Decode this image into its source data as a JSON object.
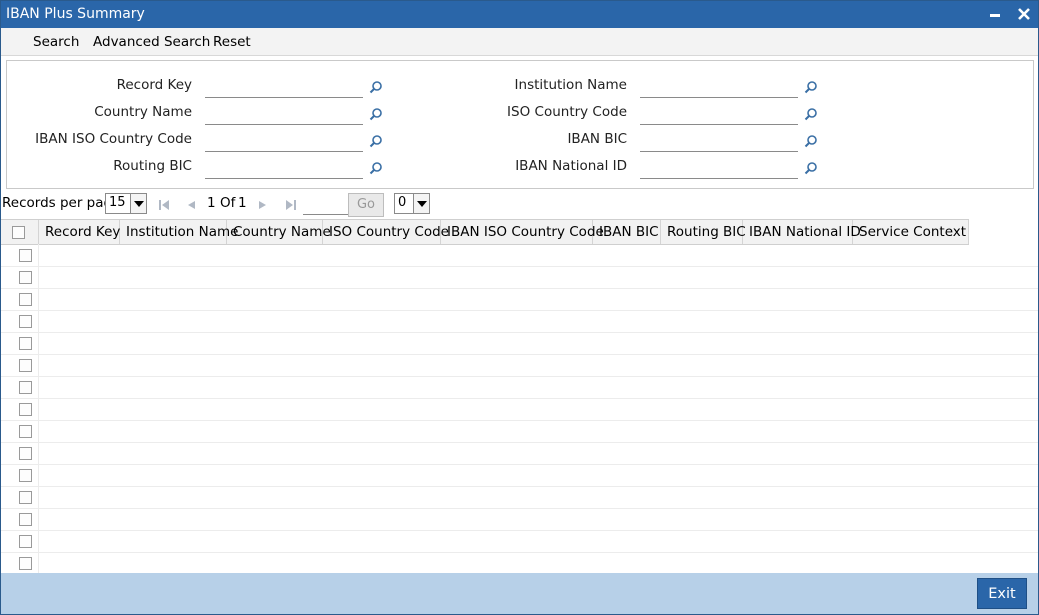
{
  "window": {
    "title": "IBAN Plus Summary"
  },
  "menu": {
    "items": [
      "Search",
      "Advanced Search",
      "Reset"
    ]
  },
  "criteria": {
    "left": [
      {
        "label": "Record Key",
        "value": ""
      },
      {
        "label": "Country Name",
        "value": ""
      },
      {
        "label": "IBAN ISO Country Code",
        "value": ""
      },
      {
        "label": "Routing BIC",
        "value": ""
      }
    ],
    "right": [
      {
        "label": "Institution Name",
        "value": ""
      },
      {
        "label": "ISO Country Code",
        "value": ""
      },
      {
        "label": "IBAN BIC",
        "value": ""
      },
      {
        "label": "IBAN National ID",
        "value": ""
      }
    ]
  },
  "pager": {
    "records_per_page_label": "Records per page",
    "records_per_page": "15",
    "current_page": "1",
    "of_label": "Of",
    "total_pages": "1",
    "go_label": "Go",
    "filter_value": "0"
  },
  "grid": {
    "columns": [
      "Record Key",
      "Institution Name",
      "Country Name",
      "ISO Country Code",
      "IBAN ISO Country Code",
      "IBAN BIC",
      "Routing BIC",
      "IBAN National ID",
      "Service Context"
    ]
  },
  "footer": {
    "exit_label": "Exit"
  },
  "colors": {
    "titlebar": "#2a66a9",
    "footer": "#b7d0e8",
    "accent": "#2a66a9"
  }
}
